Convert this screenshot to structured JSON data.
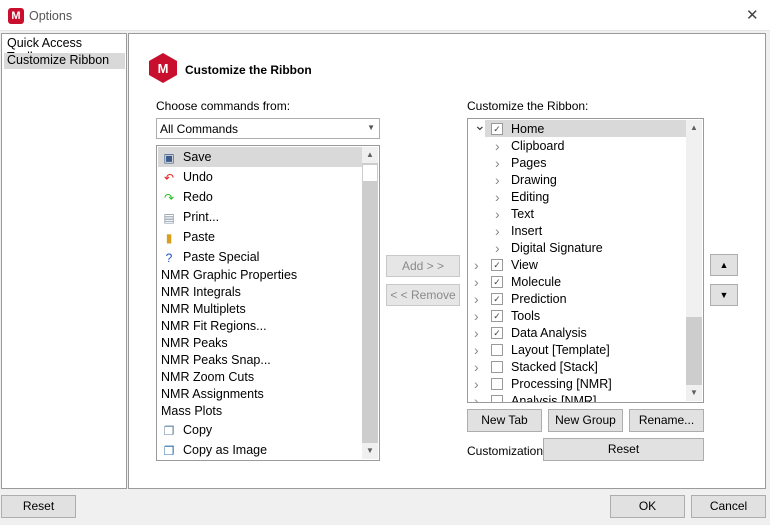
{
  "window": {
    "title": "Options",
    "close": "✕"
  },
  "nav": {
    "items": [
      {
        "label": "Quick Access Toolbar"
      },
      {
        "label": "Customize Ribbon",
        "selected": true
      }
    ]
  },
  "header": {
    "title": "Customize the Ribbon"
  },
  "left": {
    "label": "Choose commands from:",
    "dropdown": "All Commands",
    "commands": [
      {
        "label": "Save",
        "icon": "save-icon",
        "selected": true
      },
      {
        "label": "Undo",
        "icon": "undo-icon"
      },
      {
        "label": "Redo",
        "icon": "redo-icon"
      },
      {
        "label": "Print...",
        "icon": "print-icon"
      },
      {
        "label": "Paste",
        "icon": "paste-icon"
      },
      {
        "label": "Paste Special",
        "icon": "paste-special-icon"
      },
      {
        "label": "NMR Graphic Properties"
      },
      {
        "label": "NMR Integrals"
      },
      {
        "label": "NMR Multiplets"
      },
      {
        "label": "NMR Fit Regions..."
      },
      {
        "label": "NMR Peaks"
      },
      {
        "label": "NMR Peaks  Snap..."
      },
      {
        "label": "NMR Zoom  Cuts"
      },
      {
        "label": "NMR Assignments"
      },
      {
        "label": "Mass Plots"
      },
      {
        "label": "Copy",
        "icon": "copy-icon"
      },
      {
        "label": "Copy as Image",
        "icon": "copy-image-icon"
      }
    ]
  },
  "middle": {
    "add": "Add > >",
    "remove": "< < Remove"
  },
  "right": {
    "label": "Customize the Ribbon:",
    "tree": [
      {
        "label": "Home",
        "level": 0,
        "checked": true,
        "expanded": true,
        "selected": true
      },
      {
        "label": "Clipboard",
        "level": 1
      },
      {
        "label": "Pages",
        "level": 1
      },
      {
        "label": "Drawing",
        "level": 1
      },
      {
        "label": "Editing",
        "level": 1
      },
      {
        "label": "Text",
        "level": 1
      },
      {
        "label": "Insert",
        "level": 1
      },
      {
        "label": "Digital Signature",
        "level": 1
      },
      {
        "label": "View",
        "level": 0,
        "checked": true
      },
      {
        "label": "Molecule",
        "level": 0,
        "checked": true
      },
      {
        "label": "Prediction",
        "level": 0,
        "checked": true
      },
      {
        "label": "Tools",
        "level": 0,
        "checked": true
      },
      {
        "label": "Data Analysis",
        "level": 0,
        "checked": true
      },
      {
        "label": "Layout [Template]",
        "level": 0,
        "checked": false
      },
      {
        "label": "Stacked [Stack]",
        "level": 0,
        "checked": false
      },
      {
        "label": "Processing [NMR]",
        "level": 0,
        "checked": false
      },
      {
        "label": "Analysis [NMR]",
        "level": 0,
        "checked": false
      }
    ],
    "new_tab": "New Tab",
    "new_group": "New Group",
    "rename": "Rename...",
    "customizations_label": "Customizations:",
    "reset": "Reset"
  },
  "footer": {
    "reset": "Reset",
    "ok": "OK",
    "cancel": "Cancel"
  }
}
